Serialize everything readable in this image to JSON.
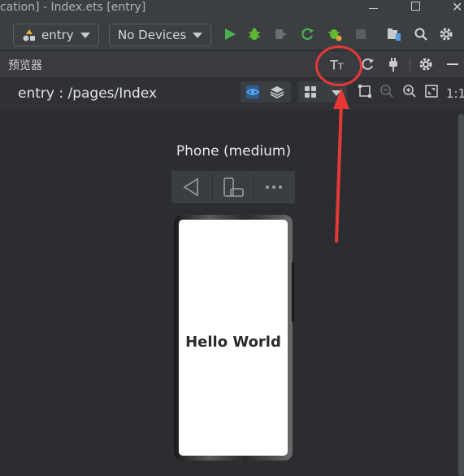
{
  "window": {
    "title": "cation] - Index.ets [entry]",
    "controls": [
      "minimize",
      "maximize",
      "close"
    ]
  },
  "toolbar": {
    "module_select": "entry",
    "device_select": "No Devices",
    "icons": [
      "run-icon",
      "debug-icon",
      "attach-debugger-icon",
      "apply-changes-icon",
      "profiler-icon",
      "stop-icon",
      "device-manager-icon",
      "search-icon",
      "settings-icon"
    ],
    "colors": {
      "run": "#4caf50",
      "debug": "#5fb832",
      "disabled": "#6b6e73"
    }
  },
  "panel": {
    "title": "预览器",
    "header_icons": [
      "font-size-icon",
      "refresh-icon",
      "plug-icon",
      "settings-icon",
      "minimize-panel-icon"
    ]
  },
  "pathbar": {
    "path": "entry : /pages/Index",
    "zoom_label": "1:1",
    "icons": [
      "inspector-icon",
      "layers-icon",
      "multi-device-icon",
      "dropdown-caret-icon",
      "fit-frame-icon",
      "zoom-out-icon",
      "zoom-in-icon",
      "fullscreen-icon"
    ]
  },
  "preview": {
    "device_name": "Phone (medium)",
    "screen_text": "Hello World",
    "device_controls": [
      "back-icon",
      "rotate-icon",
      "more-icon"
    ]
  },
  "annotations": {
    "color": "#e53935"
  }
}
